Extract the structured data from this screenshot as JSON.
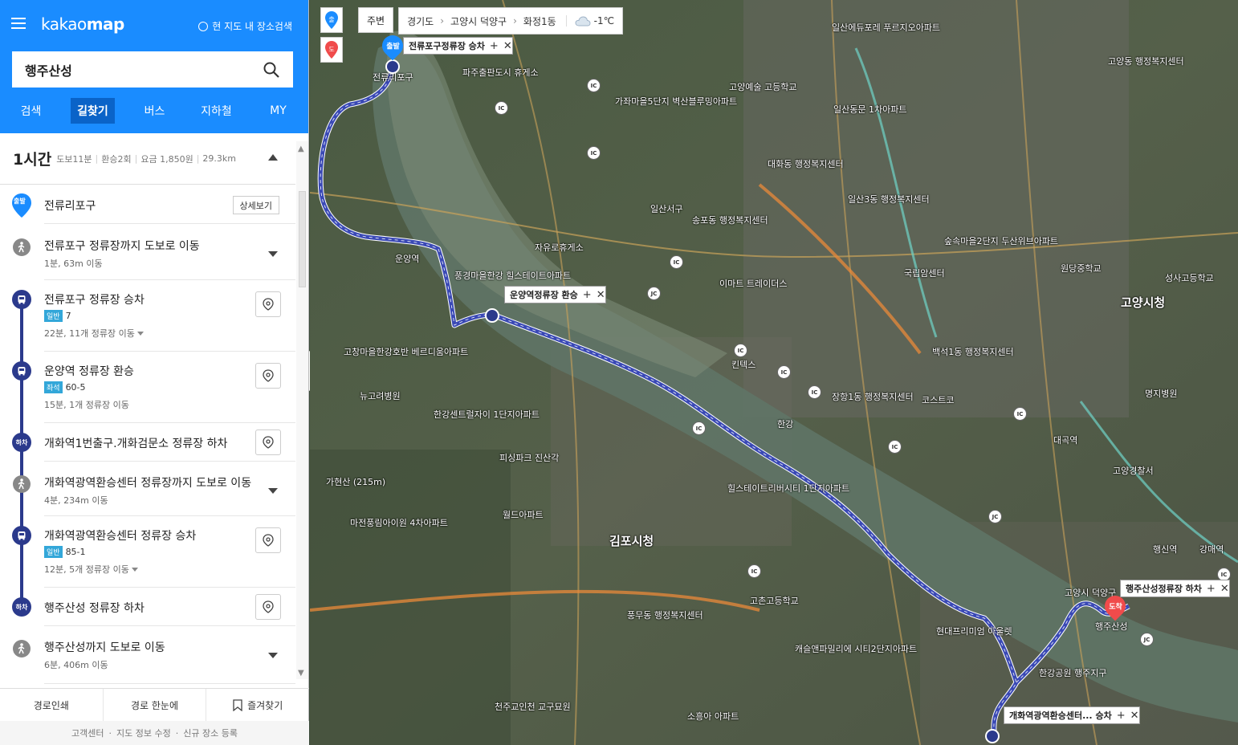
{
  "app": {
    "logo_light": "kakao",
    "logo_bold": "map",
    "map_search_toggle": "현 지도 내 장소검색"
  },
  "search": {
    "value": "행주산성"
  },
  "nav_tabs": [
    "검색",
    "길찾기",
    "버스",
    "지하철",
    "MY"
  ],
  "summary": {
    "time": "1시간",
    "walk": "도보11분",
    "transfers": "환승2회",
    "fare": "요금 1,850원",
    "distance": "29.3km"
  },
  "steps": {
    "start": {
      "badge": "출발",
      "title": "전류리포구",
      "detail_label": "상세보기"
    },
    "walk1": {
      "title": "전류포구 정류장까지 도보로 이동",
      "sub": "1분, 63m 이동"
    },
    "board1": {
      "title": "전류포구 정류장 승차",
      "tag": "일반",
      "bus": "7",
      "sub": "22분, 11개 정류장 이동"
    },
    "transfer1": {
      "title": "운양역 정류장 환승",
      "tag": "좌석",
      "bus": "60-5",
      "sub": "15분, 1개 정류장 이동"
    },
    "alight1": {
      "badge": "하차",
      "title": "개화역1번출구.개화검문소 정류장 하차"
    },
    "walk2": {
      "title": "개화역광역환승센터 정류장까지 도보로 이동",
      "sub": "4분, 234m 이동"
    },
    "board2": {
      "title": "개화역광역환승센터 정류장 승차",
      "tag": "일반",
      "bus": "85-1",
      "sub": "12분, 5개 정류장 이동"
    },
    "alight2": {
      "badge": "하차",
      "title": "행주산성 정류장 하차"
    },
    "walk3": {
      "title": "행주산성까지 도보로 이동",
      "sub": "6분, 406m 이동"
    }
  },
  "bottom": {
    "print": "경로인쇄",
    "overview": "경로 한눈에",
    "favorite": "즐겨찾기"
  },
  "footer": {
    "center": "고객센터",
    "edit": "지도 정보 수정",
    "register": "신규 장소 등록"
  },
  "map": {
    "nearby": "주변",
    "crumbs": [
      "경기도",
      "고양시 덕양구",
      "화정1동"
    ],
    "weather": "-1℃",
    "start_pin": "출",
    "end_pin": "도",
    "start_flag": "출발",
    "end_flag": "도착",
    "bubbles": {
      "b1": "전류포구정류장 승차",
      "b2": "운양역정류장 환승",
      "b3": "행주산성정류장 하차",
      "b4": "개화역광역환승센터...  승차"
    },
    "labels": {
      "l1": "전류리포구",
      "l2": "파주출판도시 휴게소",
      "l3": "가좌마을5단지 벽산블루밍아파트",
      "l4": "고양예술 고등학교",
      "l5": "일산동문 1차아파트",
      "l6": "대화동 행정복지센터",
      "l7": "일산3동 행정복지센터",
      "l8": "일산서구",
      "l9": "송포동 행정복지센터",
      "l10": "자유로휴게소",
      "l11": "운양역",
      "l12": "풍경마을한강 힐스테이트아파트",
      "l13": "이마트 트레이더스",
      "l14": "고양시청",
      "l15": "김포시청",
      "l16": "한강",
      "l17": "국립암센터",
      "l18": "백석1동 행정복지센터",
      "l19": "장항1동 행정복지센터",
      "l20": "킨텍스",
      "l21": "코스트코",
      "l22": "대곡역",
      "l23": "고양경찰서",
      "l24": "행주산성",
      "l25": "현대프리미엄 아울렛",
      "l26": "캐슬앤파밀리에 시티2단지아파트",
      "l27": "고양동 행정복지센터",
      "l28": "월드아파트",
      "l29": "피싱파크 진산각",
      "l30": "마전풍림아이원 4차아파트",
      "l31": "고창마을한강호반 베르디움아파트",
      "l32": "일산에듀포레 푸르지오아파트",
      "l33": "성사고등학교",
      "l34": "명지병원",
      "l35": "행신역",
      "l36": "강매역",
      "l37": "원당중학교",
      "l38": "숲속마을2단지 두산위브아파트",
      "l39": "힐스테이트리버시티 1단지아파트",
      "l40": "한강센트럴자이 1단지아파트",
      "l41": "뉴고려병원",
      "l42": "고양시 덕양구",
      "l43": "가현산 (215m)",
      "l44": "고촌고등학교",
      "l45": "풍무동 행정복지센터",
      "l46": "한강공원 행주지구",
      "l47": "천주교인천 교구묘원",
      "l48": "소흥아 아파트"
    }
  }
}
